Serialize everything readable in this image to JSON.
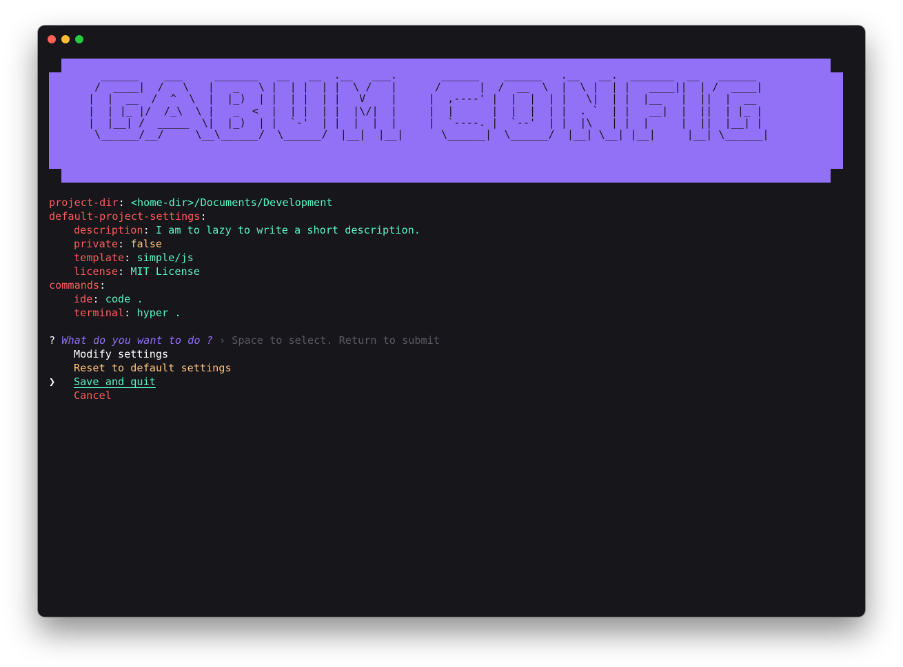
{
  "window": {
    "controls": [
      "close",
      "minimize",
      "maximize"
    ]
  },
  "banner": {
    "text": "GABUM CONFIG",
    "ascii": "  ______    ___     _______   __   __  .__   ___.       ______    ______   .__   __.  _______  __   ______  \n /  ____|  /   \\   |   _   \\ |  | |  | |  \\ /   |      /      |  /  __  \\  |  \\ |  | |   ____||  | /  ____| \n|  |  __  /  ^  \\  |  |_)  | |  | |  | |   V    |     |  ,----' |  |  |  | |   \\|  | |  |__   |  ||  |  __  \n|  | |_ |/  /_\\  \\ |   _  <  |  | |  | |  |\\/|  |     |  |      |  |  |  | |  . `  | |   __|  |  ||  | |_ | \n|  |__| /  _____  \\|  |_)  | |  `-'  | |  |  |  |     |  `----. |  `--'  | |  |\\   | |  |     |  ||  |__| | \n \\______/__/     \\__\\______/  \\______/  |__|  |__|      \\______|  \\______/  |__| \\__| |__|     |__| \\______| ",
    "color": "#9271f7"
  },
  "config": {
    "project_dir": {
      "key": "project-dir",
      "value": "<home-dir>/Documents/Development"
    },
    "default_project_settings": {
      "key": "default-project-settings",
      "description": {
        "key": "description",
        "value": "I am to lazy to write a short description."
      },
      "private": {
        "key": "private",
        "value": "false"
      },
      "template": {
        "key": "template",
        "value": "simple/js"
      },
      "license": {
        "key": "license",
        "value": "MIT License"
      }
    },
    "commands": {
      "key": "commands",
      "ide": {
        "key": "ide",
        "value": "code ."
      },
      "terminal": {
        "key": "terminal",
        "value": "hyper ."
      }
    }
  },
  "prompt": {
    "mark": "?",
    "question": "What do you want to do ?",
    "hint": "› Space to select. Return to submit",
    "pointer": "❯",
    "options": [
      {
        "label": "Modify settings"
      },
      {
        "label": "Reset to default settings"
      },
      {
        "label": "Save and quit",
        "selected": true
      },
      {
        "label": "Cancel"
      }
    ]
  },
  "colors": {
    "background": "#16161b",
    "key": "#ff5c5c",
    "string": "#5af5c4",
    "boolean": "#ffc07a",
    "accent": "#9271f7",
    "hint": "#5a5a63"
  }
}
